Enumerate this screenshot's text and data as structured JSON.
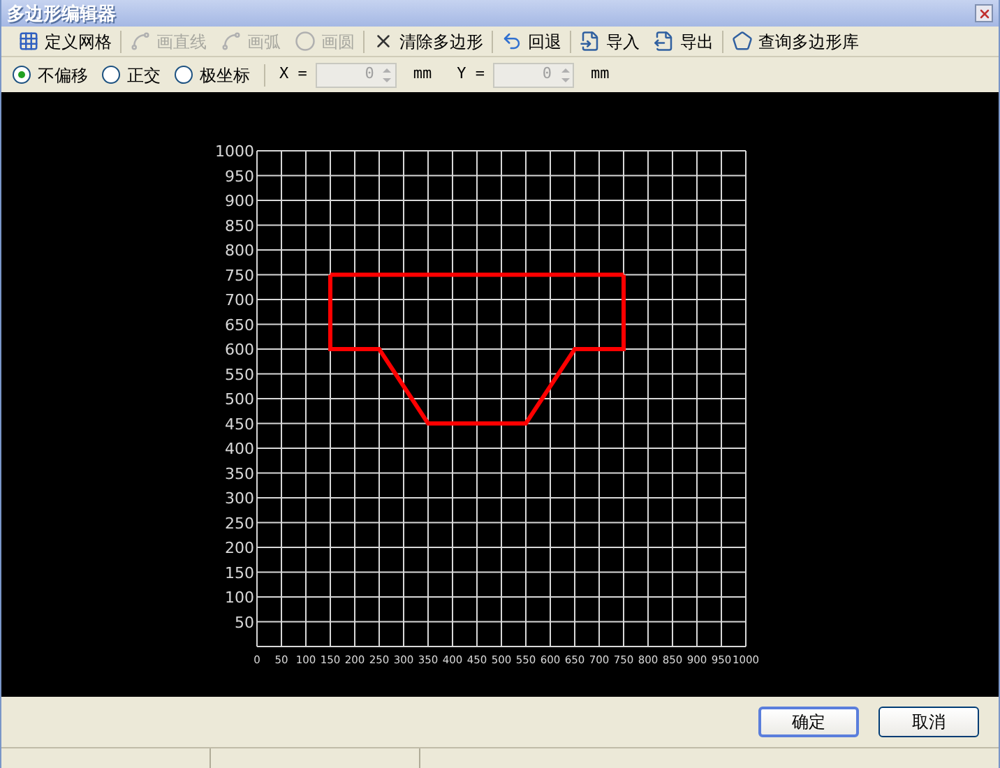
{
  "window": {
    "title": "多边形编辑器"
  },
  "toolbar": [
    {
      "kind": "grid",
      "label": "定义网格",
      "disabled": false
    },
    {
      "kind": "line",
      "label": "画直线",
      "disabled": true
    },
    {
      "kind": "arc",
      "label": "画弧",
      "disabled": true
    },
    {
      "kind": "circle",
      "label": "画圆",
      "disabled": true
    },
    {
      "kind": "clear",
      "label": "清除多边形",
      "disabled": false
    },
    {
      "kind": "undo",
      "label": "回退",
      "disabled": false
    },
    {
      "kind": "import",
      "label": "导入",
      "disabled": false
    },
    {
      "kind": "export",
      "label": "导出",
      "disabled": false
    },
    {
      "kind": "library",
      "label": "查询多边形库",
      "disabled": false
    }
  ],
  "snap_modes": [
    {
      "label": "不偏移",
      "selected": true
    },
    {
      "label": "正交",
      "selected": false
    },
    {
      "label": "极坐标",
      "selected": false
    }
  ],
  "coords": [
    {
      "label": "X =",
      "value": "0",
      "unit": "mm"
    },
    {
      "label": "Y =",
      "value": "0",
      "unit": "mm"
    }
  ],
  "canvas": {
    "chart_data": {
      "type": "line",
      "grid": true,
      "x": [
        150,
        150,
        250,
        350,
        550,
        650,
        750,
        750
      ],
      "series": [
        {
          "color": "#ff0000",
          "values": [
            750,
            750,
            750,
            750,
            750,
            750,
            750,
            750
          ]
        },
        {
          "color": "#ff0000",
          "values": [
            750,
            600,
            600,
            450,
            450,
            600,
            600,
            750
          ]
        }
      ],
      "xlim": [
        0,
        1000
      ],
      "ylim": [
        0,
        1000
      ],
      "xticks": [
        0,
        50,
        100,
        150,
        200,
        250,
        300,
        350,
        400,
        450,
        500,
        550,
        600,
        650,
        700,
        750,
        800,
        850,
        900,
        950,
        1000
      ],
      "yticks": [
        50,
        100,
        150,
        200,
        250,
        300,
        350,
        400,
        450,
        500,
        550,
        600,
        650,
        700,
        750,
        800,
        850,
        900,
        950,
        1000
      ]
    }
  },
  "buttons": [
    "确定",
    "取消"
  ]
}
